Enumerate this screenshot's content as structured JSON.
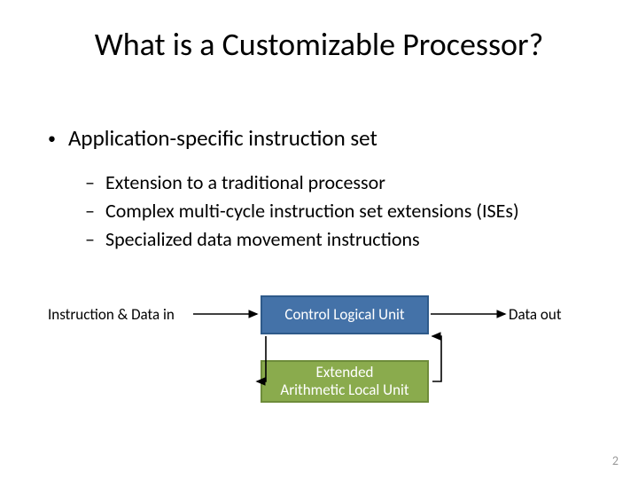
{
  "title": "What is a Customizable Processor?",
  "bullet1": "Application-specific instruction set",
  "subs": {
    "s1": "Extension to a traditional processor",
    "s2": "Complex multi-cycle instruction set extensions (ISEs)",
    "s3": "Specialized data movement instructions"
  },
  "labels": {
    "in": "Instruction  & Data in",
    "out": "Data out"
  },
  "boxes": {
    "clu": "Control Logical Unit",
    "ealu": "Extended\nArithmetic Local Unit"
  },
  "page_number": "2"
}
